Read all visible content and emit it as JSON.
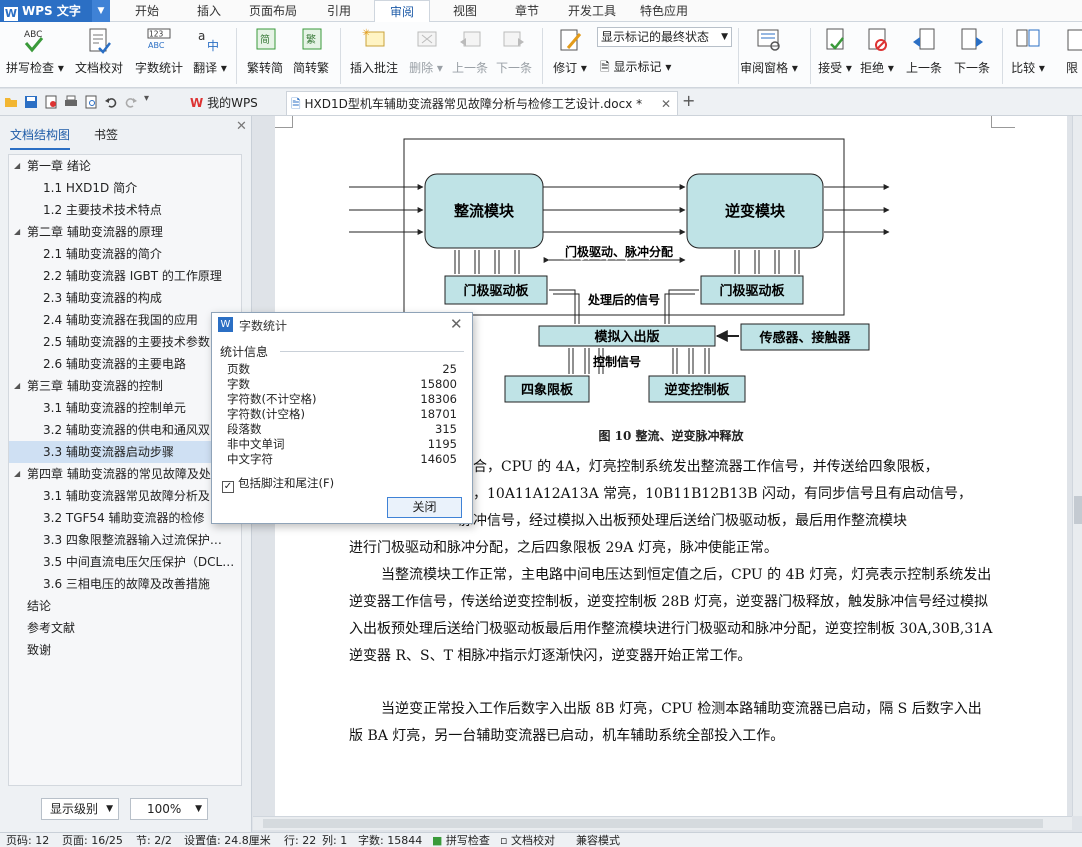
{
  "app": {
    "name": "WPS 文字"
  },
  "menu": {
    "tabs": [
      "开始",
      "插入",
      "页面布局",
      "引用",
      "审阅",
      "视图",
      "章节",
      "开发工具",
      "特色应用"
    ],
    "active": "审阅"
  },
  "ribbon": {
    "spell": "拼写检查",
    "proof": "文档校对",
    "wordcount": "字数统计",
    "translate": "翻译",
    "trad2simp": "繁转简",
    "simp2trad": "简转繁",
    "insert_comment": "插入批注",
    "delete": "删除",
    "prev": "上一条",
    "next": "下一条",
    "revise": "修订",
    "markup_mode": "显示标记的最终状态",
    "show_markup": "显示标记",
    "review_pane": "审阅窗格",
    "accept": "接受",
    "reject": "拒绝",
    "prev2": "上一条",
    "next2": "下一条",
    "compare": "比较",
    "restrict": "限"
  },
  "doctabs": {
    "mywps": "我的WPS",
    "doc": "HXD1D型机车辅助变流器常见故障分析与检修工艺设计.docx *"
  },
  "nav": {
    "tab_outline": "文档结构图",
    "tab_bookmark": "书签",
    "items": [
      {
        "text": "第一章  绪论",
        "level": 1
      },
      {
        "text": "1.1 HXD1D 简介",
        "level": 2
      },
      {
        "text": "1.2  主要技术技术特点",
        "level": 2
      },
      {
        "text": "第二章  辅助变流器的原理",
        "level": 1
      },
      {
        "text": "2.1  辅助变流器的简介",
        "level": 2
      },
      {
        "text": "2.2  辅助变流器 IGBT 的工作原理",
        "level": 2
      },
      {
        "text": "2.3  辅助变流器的构成",
        "level": 2
      },
      {
        "text": "2.4  辅助变流器在我国的应用",
        "level": 2
      },
      {
        "text": "2.5  辅助变流器的主要技术参数",
        "level": 2
      },
      {
        "text": "2.6  辅助变流器的主要电路",
        "level": 2
      },
      {
        "text": "第三章  辅助变流器的控制",
        "level": 1
      },
      {
        "text": "3.1  辅助变流器的控制单元",
        "level": 2
      },
      {
        "text": "3.2  辅助变流器的供电和通风双",
        "level": 2
      },
      {
        "text": "3.3  辅助变流器启动步骤",
        "level": 2
      },
      {
        "text": "第四章  辅助变流器的常见故障及处",
        "level": 1
      },
      {
        "text": "3.1  辅助变流器常见故障分析及",
        "level": 2
      },
      {
        "text": "3.2 TGF54 辅助变流器的检修",
        "level": 2
      },
      {
        "text": "3.3  四象限整流器输入过流保护…",
        "level": 2
      },
      {
        "text": "3.5  中间直流电压欠压保护（DCL…",
        "level": 2
      },
      {
        "text": "3.6  三相电压的故障及改善措施",
        "level": 2
      },
      {
        "text": "结论",
        "level": 0
      },
      {
        "text": "参考文献",
        "level": 0
      },
      {
        "text": "致谢",
        "level": 0
      }
    ],
    "show_level": "显示级别",
    "zoom": "100%"
  },
  "figure": {
    "rectifier": "整流模块",
    "inverter": "逆变模块",
    "gate_dist": "门极驱动、脉冲分配",
    "gate_board_left": "门极驱动板",
    "gate_board_right": "门极驱动板",
    "processed": "处理后的信号",
    "analog_io": "模拟入出版",
    "sensor": "传感器、接触器",
    "control_sig": "控制信号",
    "four_quad": "四象限板",
    "inv_ctrl": "逆变控制板",
    "caption": "图 10  整流、逆变脉冲释放"
  },
  "document": {
    "p1_l1": "闭合，CPU 的 4A，灯亮控制系统发出整流器工作信号，并传送给四象限板，",
    "p1_l2": "亮，10A11A12A13A 常亮，10B11B12B13B 闪动，有同步信号且有启动信号，",
    "p1_l3": "脉冲信号，经过模拟入出板预处理后送给门极驱动板，最后用作整流模块",
    "p1_l4": "进行门极驱动和脉冲分配，之后四象限板 29A 灯亮，脉冲使能正常。",
    "p2": "当整流模块工作正常，主电路中间电压达到恒定值之后，CPU 的 4B 灯亮，灯亮表示控制系统发出逆变器工作信号，传送给逆变控制板，逆变控制板 28B 灯亮，逆变器门极释放，触发脉冲信号经过模拟入出板预处理后送给门极驱动板最后用作整流模块进行门极驱动和脉冲分配，逆变控制板 30A,30B,31A 逆变器 R、S、T 相脉冲指示灯逐渐快闪，逆变器开始正常工作。",
    "p3": "当逆变正常投入工作后数字入出版 8B 灯亮，CPU 检测本路辅助变流器已启动，隔 S 后数字入出版 BA 灯亮，另一台辅助变流器已启动，机车辅助系统全部投入工作。"
  },
  "wordcount": {
    "title": "字数统计",
    "group": "统计信息",
    "rows": [
      {
        "k": "页数",
        "v": "25"
      },
      {
        "k": "字数",
        "v": "15800"
      },
      {
        "k": "字符数(不计空格)",
        "v": "18306"
      },
      {
        "k": "字符数(计空格)",
        "v": "18701"
      },
      {
        "k": "段落数",
        "v": "315"
      },
      {
        "k": "非中文单词",
        "v": "1195"
      },
      {
        "k": "中文字符",
        "v": "14605"
      }
    ],
    "include": "包括脚注和尾注(F)",
    "close": "关闭"
  },
  "status": {
    "pageno": "页码: 12",
    "page": "页面: 16/25",
    "section": "节: 2/2",
    "setting": "设置值: 24.8厘米",
    "row": "行: 22",
    "col": "列: 1",
    "words": "字数: 15844",
    "spell": "拼写检查",
    "proof": "文档校对",
    "compat": "兼容模式"
  }
}
